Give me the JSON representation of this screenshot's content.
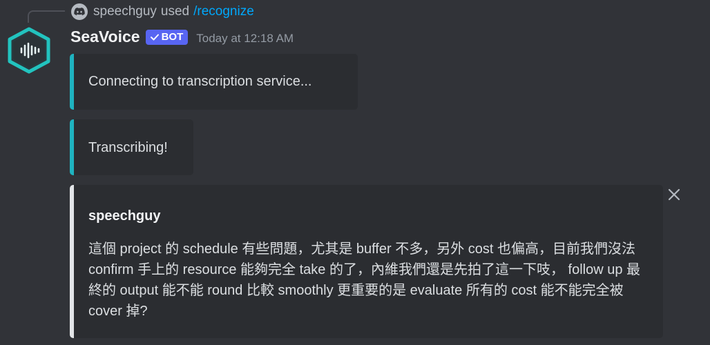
{
  "reply": {
    "user": "speechguy",
    "used": "used",
    "command": "/recognize"
  },
  "message": {
    "author": "SeaVoice",
    "badge": "BOT",
    "timestamp": "Today at 12:18 AM"
  },
  "embeds": [
    {
      "text": "Connecting to transcription service..."
    },
    {
      "text": "Transcribing!"
    },
    {
      "author": "speechguy",
      "body": "這個 project 的 schedule 有些問題，尤其是 buffer 不多，另外 cost 也偏高，目前我們沒法 confirm 手上的 resource 能夠完全 take 的了，內維我們還是先拍了這一下吱， follow up 最終的 output 能不能 round 比較 smoothly 更重要的是 evaluate 所有的 cost 能不能完全被 cover 掉?"
    }
  ],
  "colors": {
    "background": "#313338",
    "embed_bg": "#2b2d31",
    "accent_teal": "#1fb3c0",
    "transcript_border": "#e3e5e8",
    "badge": "#5865f2",
    "command_link": "#00a8fc"
  },
  "icons": {
    "reply_avatar": "discord-icon",
    "bot_avatar": "soundwave-hexagon-icon",
    "badge_check": "checkmark-icon",
    "close": "close-icon"
  }
}
